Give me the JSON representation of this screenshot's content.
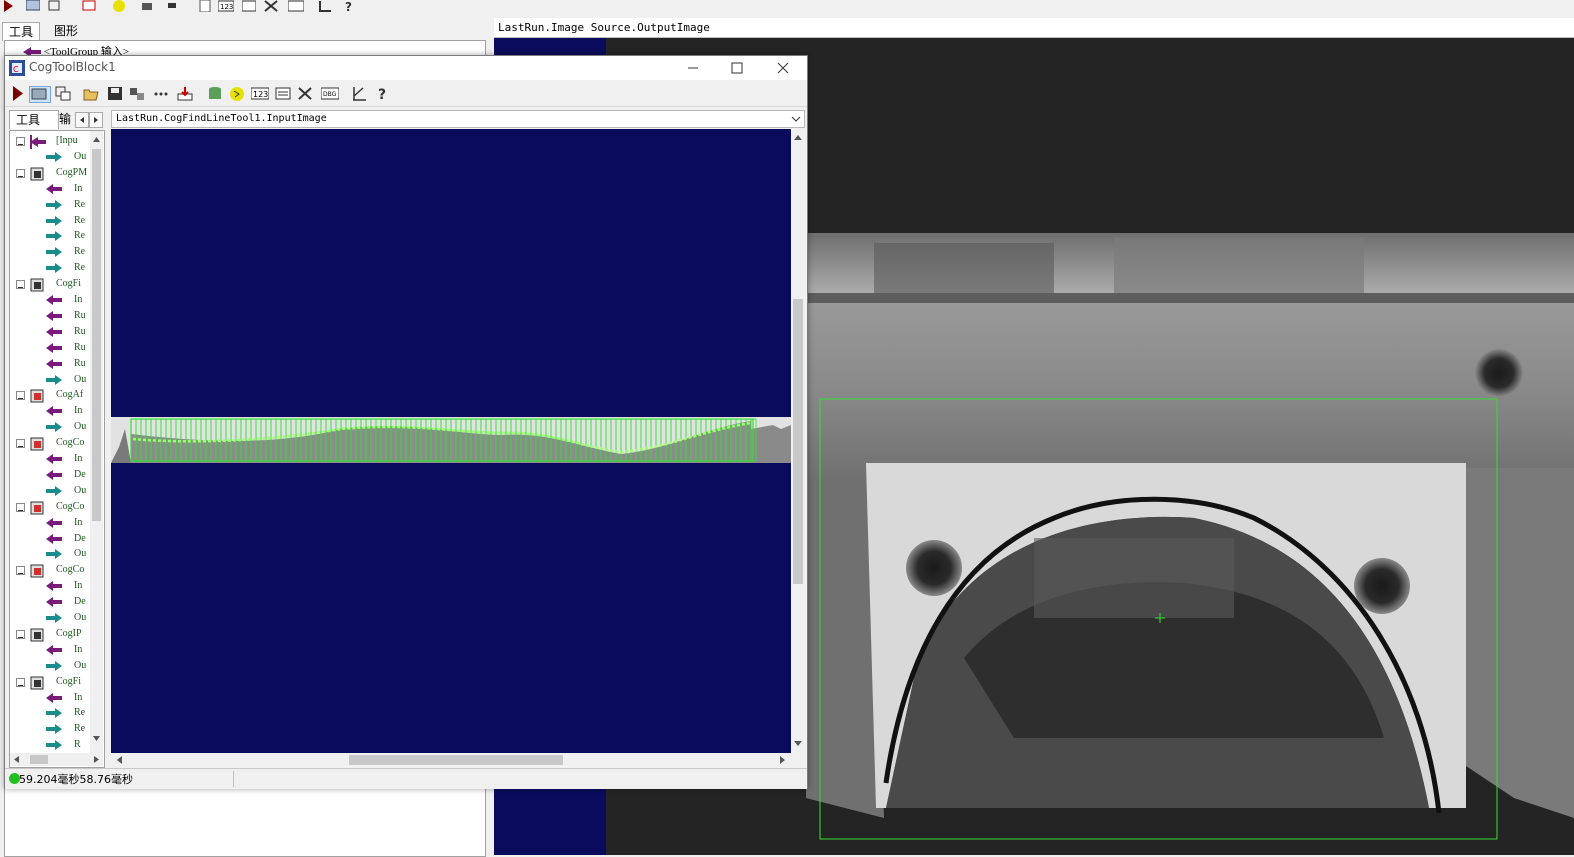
{
  "app": {
    "left_tabs": [
      "工具",
      "图形"
    ],
    "tree_first_item": "<ToolGroup 输入>"
  },
  "display": {
    "title": "LastRun.Image Source.OutputImage"
  },
  "window": {
    "title": "CogToolBlock1",
    "tabs": [
      "工具",
      "输"
    ],
    "image_title": "LastRun.CogFindLineTool1.InputImage",
    "status": "59.204毫秒58.76毫秒",
    "status_color": "#20c020"
  },
  "tree": [
    {
      "label": "[Inpu",
      "level": 0,
      "icon": "input-icon"
    },
    {
      "label": "Ou",
      "level": 1,
      "icon": "output-arrow-icon"
    },
    {
      "label": "CogPM",
      "level": 0,
      "icon": "pmalign-tool-icon"
    },
    {
      "label": "In",
      "level": 1,
      "icon": "input-arrow-icon"
    },
    {
      "label": "Re",
      "level": 1,
      "icon": "output-arrow-icon"
    },
    {
      "label": "Re",
      "level": 1,
      "icon": "output-arrow-icon"
    },
    {
      "label": "Re",
      "level": 1,
      "icon": "output-arrow-icon"
    },
    {
      "label": "Re",
      "level": 1,
      "icon": "output-arrow-icon"
    },
    {
      "label": "Re",
      "level": 1,
      "icon": "output-arrow-icon"
    },
    {
      "label": "CogFi",
      "level": 0,
      "icon": "fixture-tool-icon"
    },
    {
      "label": "In",
      "level": 1,
      "icon": "input-arrow-icon"
    },
    {
      "label": "Ru",
      "level": 1,
      "icon": "input-arrow-icon"
    },
    {
      "label": "Ru",
      "level": 1,
      "icon": "input-arrow-icon"
    },
    {
      "label": "Ru",
      "level": 1,
      "icon": "input-arrow-icon"
    },
    {
      "label": "Ru",
      "level": 1,
      "icon": "input-arrow-icon"
    },
    {
      "label": "Ou",
      "level": 1,
      "icon": "output-arrow-icon"
    },
    {
      "label": "CogAf",
      "level": 0,
      "icon": "affine-tool-icon"
    },
    {
      "label": "In",
      "level": 1,
      "icon": "input-arrow-icon"
    },
    {
      "label": "Ou",
      "level": 1,
      "icon": "output-arrow-icon"
    },
    {
      "label": "CogCo",
      "level": 0,
      "icon": "copy-region-tool-icon"
    },
    {
      "label": "In",
      "level": 1,
      "icon": "input-arrow-icon"
    },
    {
      "label": "De",
      "level": 1,
      "icon": "input-arrow-icon"
    },
    {
      "label": "Ou",
      "level": 1,
      "icon": "output-arrow-icon"
    },
    {
      "label": "CogCo",
      "level": 0,
      "icon": "copy-region-tool-icon"
    },
    {
      "label": "In",
      "level": 1,
      "icon": "input-arrow-icon"
    },
    {
      "label": "De",
      "level": 1,
      "icon": "input-arrow-icon"
    },
    {
      "label": "Ou",
      "level": 1,
      "icon": "output-arrow-icon"
    },
    {
      "label": "CogCo",
      "level": 0,
      "icon": "copy-region-tool-icon"
    },
    {
      "label": "In",
      "level": 1,
      "icon": "input-arrow-icon"
    },
    {
      "label": "De",
      "level": 1,
      "icon": "input-arrow-icon"
    },
    {
      "label": "Ou",
      "level": 1,
      "icon": "output-arrow-icon"
    },
    {
      "label": "CogIP",
      "level": 0,
      "icon": "ipone-tool-icon"
    },
    {
      "label": "In",
      "level": 1,
      "icon": "input-arrow-icon"
    },
    {
      "label": "Ou",
      "level": 1,
      "icon": "output-arrow-icon"
    },
    {
      "label": "CogFi",
      "level": 0,
      "icon": "findline-tool-icon"
    },
    {
      "label": "In",
      "level": 1,
      "icon": "input-arrow-icon"
    },
    {
      "label": "Re",
      "level": 1,
      "icon": "output-arrow-icon"
    },
    {
      "label": "Re",
      "level": 1,
      "icon": "output-arrow-icon"
    },
    {
      "label": "R",
      "level": 1,
      "icon": "output-arrow-icon"
    }
  ],
  "colors": {
    "image_bg": "#0b0b5c",
    "caliper_green": "#33e033",
    "input_arrow": "#7a1a7a",
    "output_arrow": "#1a8c8c"
  }
}
